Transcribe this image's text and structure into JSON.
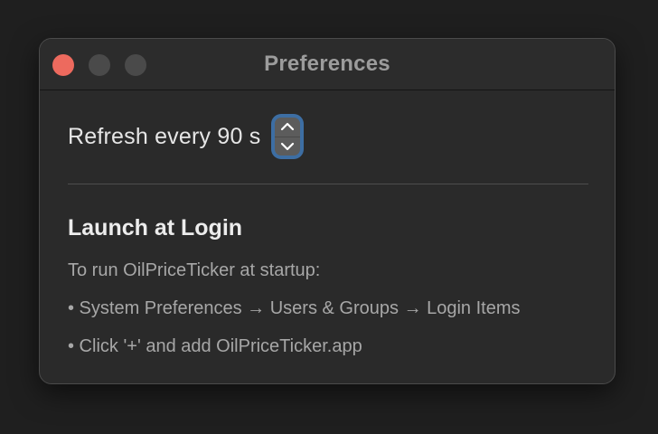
{
  "window": {
    "title": "Preferences",
    "buttons": {
      "close_color": "#ed6a5e",
      "inactive_color": "#4a4a4a"
    }
  },
  "refresh": {
    "label": "Refresh every 90 s",
    "interval_seconds": 90,
    "stepper_up_icon": "chevron-up-icon",
    "stepper_down_icon": "chevron-down-icon",
    "stepper_focus_color": "#3d6ea3"
  },
  "launch": {
    "heading": "Launch at Login",
    "intro": "To run OilPriceTicker at startup:",
    "steps": [
      "• System Preferences → Users & Groups → Login Items",
      "• Click '+' and add OilPriceTicker.app"
    ]
  }
}
